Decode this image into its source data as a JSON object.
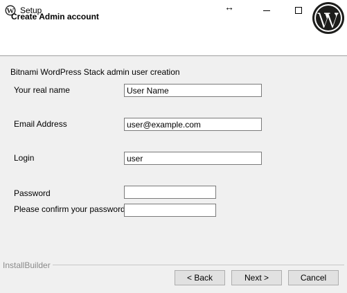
{
  "window": {
    "title": "Setup",
    "resize_glyph": "↔",
    "icons": {
      "app": "wordpress-icon",
      "minimize": "minimize-icon",
      "maximize": "maximize-icon",
      "close": "close-icon"
    }
  },
  "header": {
    "title": "Create Admin account",
    "logo": "wordpress-logo-icon"
  },
  "form": {
    "intro": "Bitnami WordPress Stack admin user creation",
    "real_name": {
      "label": "Your real name",
      "value": "User Name"
    },
    "email": {
      "label": "Email Address",
      "value": "user@example.com"
    },
    "login": {
      "label": "Login",
      "value": "user"
    },
    "password": {
      "label": "Password",
      "value": ""
    },
    "confirm_password": {
      "label": "Please confirm your password",
      "value": ""
    }
  },
  "footer": {
    "brand": "InstallBuilder",
    "back_label": "< Back",
    "next_label": "Next >",
    "cancel_label": "Cancel"
  },
  "colors": {
    "dialog_background": "#f0f0f0",
    "header_background": "#ffffff",
    "button_face": "#e1e1e1",
    "wordpress_logo": "#1d1d1b"
  }
}
